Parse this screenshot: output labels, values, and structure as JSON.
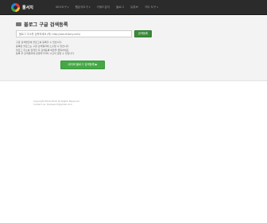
{
  "brand": {
    "name": "툴서치"
  },
  "nav": {
    "items": [
      {
        "label": "SEO도구",
        "has_caret": true
      },
      {
        "label": "웹분석도구",
        "has_caret": true
      },
      {
        "label": "키워드분석",
        "has_caret": false
      },
      {
        "label": "블로그",
        "has_caret": false
      },
      {
        "label": "유튜브",
        "has_caret": false
      },
      {
        "label": "기타 도구",
        "has_caret": true
      }
    ]
  },
  "main": {
    "title": "블로그 구글 검색등록",
    "url_input": {
      "value": "",
      "placeholder": "블로그 주소를 입력하세요 (예: http://ooo.tistory.com)"
    },
    "submit_label": "검색등록",
    "description": [
      "구글 검색엔진에 블로그를 등록할 수 있습니다.",
      "등록된 블로그는 구글 검색결과에 노출될 수 있습니다.",
      "블로그 주소를 입력한 후 검색등록 버튼을 클릭하세요.",
      "등록 후 검색결과에 반영되기까지 시간이 걸릴 수 있습니다."
    ],
    "cta_label": "네이버 블로그 검색등록 ▶"
  },
  "footer": {
    "lines": [
      "Copyright 2014-2019 All Rights Reserved",
      "Contact us: toolsearch@gmail.com"
    ]
  },
  "colors": {
    "navbar": "#2b2b2b",
    "jumbotron": "#f3f3f3",
    "accent_green": "#45a845",
    "submit_green": "#3a8a3a"
  }
}
